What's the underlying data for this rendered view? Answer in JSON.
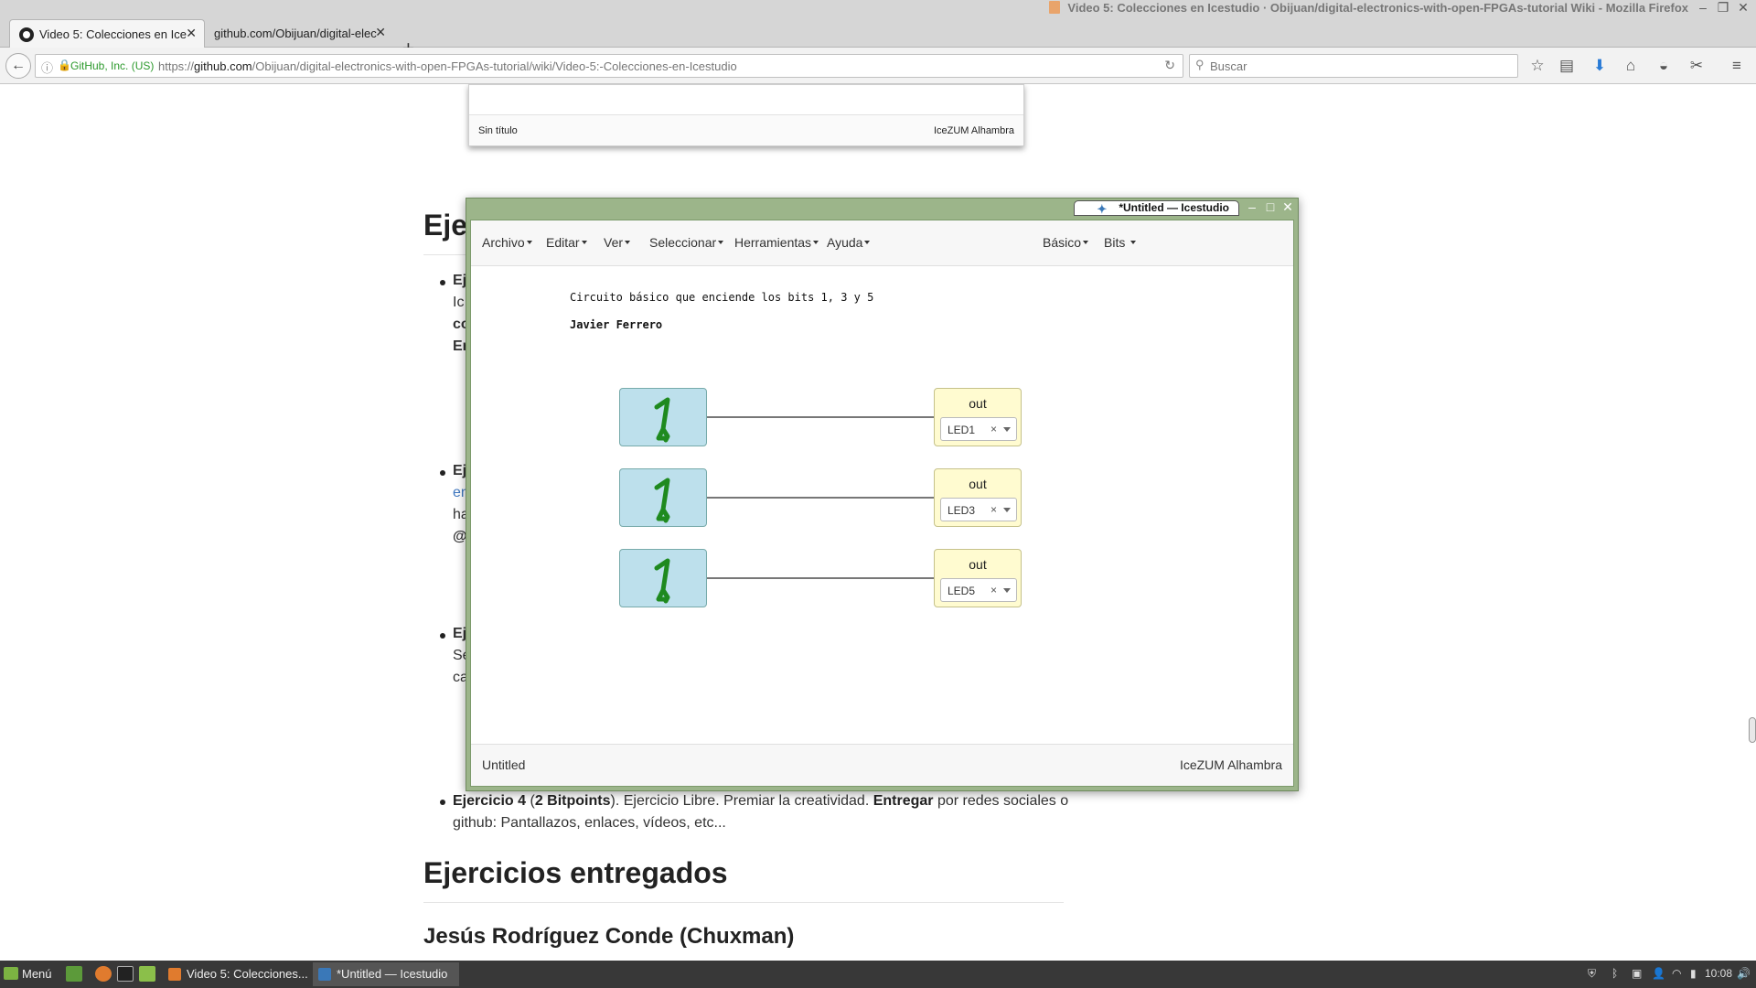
{
  "firefox": {
    "window_title": "Video 5: Colecciones en Icestudio · Obijuan/digital-electronics-with-open-FPGAs-tutorial Wiki - Mozilla Firefox",
    "tabs": [
      {
        "label": "Video 5: Colecciones en Ice",
        "active": true
      },
      {
        "label": "github.com/Obijuan/digital-elec",
        "active": false
      }
    ],
    "url": {
      "org_badge": "GitHub, Inc. (US)",
      "prefix": "https://",
      "domain": "github.com",
      "path": "/Obijuan/digital-electronics-with-open-FPGAs-tutorial/wiki/Video-5:-Colecciones-en-Icestudio"
    },
    "search_placeholder": "Buscar"
  },
  "page": {
    "top_image": {
      "left_caption": "Sin título",
      "right_caption": "IceZUM Alhambra"
    },
    "heading_partial": "Eje",
    "fragments": {
      "f1": "Ej",
      "f2": "Ic",
      "f3": "co",
      "f4": "Er",
      "f5": "Ej",
      "f6": "en",
      "f7": "ha",
      "f8": "@",
      "f9": "Ej",
      "f10": "Se",
      "f11": "ca"
    },
    "exercise4": {
      "title": "Ejercicio 4",
      "points_open": " (",
      "points": "2 Bitpoints",
      "text1": "). Ejercicio Libre. Premiar la creatividad. ",
      "deliver": "Entregar",
      "text2": " por redes sociales o github: Pantallazos, enlaces, vídeos, etc..."
    },
    "section_heading": "Ejercicios entregados",
    "subheading": "Jesús Rodríguez Conde (Chuxman)"
  },
  "icestudio": {
    "title": "*Untitled — Icestudio",
    "menus": [
      "Archivo",
      "Editar",
      "Ver",
      "Seleccionar",
      "Herramientas",
      "Ayuda"
    ],
    "menus_right": [
      "Básico",
      "Bits"
    ],
    "comment": "Circuito básico que enciende los bits 1, 3 y 5",
    "author": "Javier Ferrero",
    "blocks": [
      {
        "constant": "1",
        "output_label": "out",
        "pin": "LED1"
      },
      {
        "constant": "1",
        "output_label": "out",
        "pin": "LED3"
      },
      {
        "constant": "1",
        "output_label": "out",
        "pin": "LED5"
      }
    ],
    "footer_left": "Untitled",
    "footer_right": "IceZUM Alhambra",
    "colors": {
      "frame": "#9cb58a",
      "bit_block": "#bde0ec",
      "out_block": "#fffbd0",
      "constant_glyph": "#1f8a1f"
    }
  },
  "taskbar": {
    "menu_label": "Menú",
    "windows": [
      {
        "label": "Video 5: Colecciones...",
        "active": false
      },
      {
        "label": "*Untitled — Icestudio",
        "active": true
      }
    ],
    "clock": "10:08"
  }
}
